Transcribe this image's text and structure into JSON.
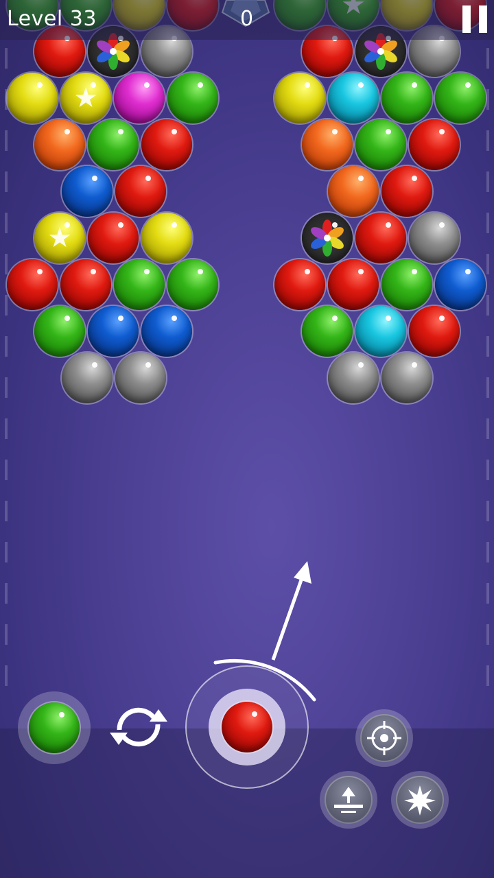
{
  "hud": {
    "level_label": "Level 33",
    "score": "0",
    "pause_icon": "pause-icon",
    "gem_icon": "gem-icon"
  },
  "board": {
    "left_cluster": [
      [
        "green",
        "green",
        "yellow",
        "red",
        "gem"
      ],
      [
        "red",
        "rainbow",
        "gray"
      ],
      [
        "yellow",
        "yellow-star",
        "magenta",
        "green"
      ],
      [
        "orange",
        "green",
        "red"
      ],
      [
        "blue",
        "red"
      ],
      [
        "yellow-star",
        "red",
        "yellow"
      ],
      [
        "red",
        "red",
        "green",
        "green"
      ],
      [
        "green",
        "blue",
        "blue"
      ],
      [
        "gray",
        "gray"
      ]
    ],
    "right_cluster": [
      [
        "green",
        "green-star",
        "yellow",
        "red"
      ],
      [
        "red",
        "rainbow",
        "gray"
      ],
      [
        "yellow",
        "cyan",
        "green",
        "green"
      ],
      [
        "orange",
        "green",
        "red"
      ],
      [
        "orange",
        "red"
      ],
      [
        "rainbow",
        "red",
        "gray"
      ],
      [
        "red",
        "red",
        "green",
        "blue"
      ],
      [
        "green",
        "cyan",
        "red"
      ],
      [
        "gray",
        "gray"
      ]
    ]
  },
  "shooter": {
    "current_bubble": "red",
    "next_bubble": "green",
    "swap_icon": "swap-icon",
    "aim_arrow_icon": "aim-arrow-icon"
  },
  "tools": [
    {
      "name": "target-icon"
    },
    {
      "name": "raise-icon"
    },
    {
      "name": "bomb-icon"
    }
  ],
  "colors": {
    "background": "#4e4296",
    "top_bar": "#2e2850"
  }
}
